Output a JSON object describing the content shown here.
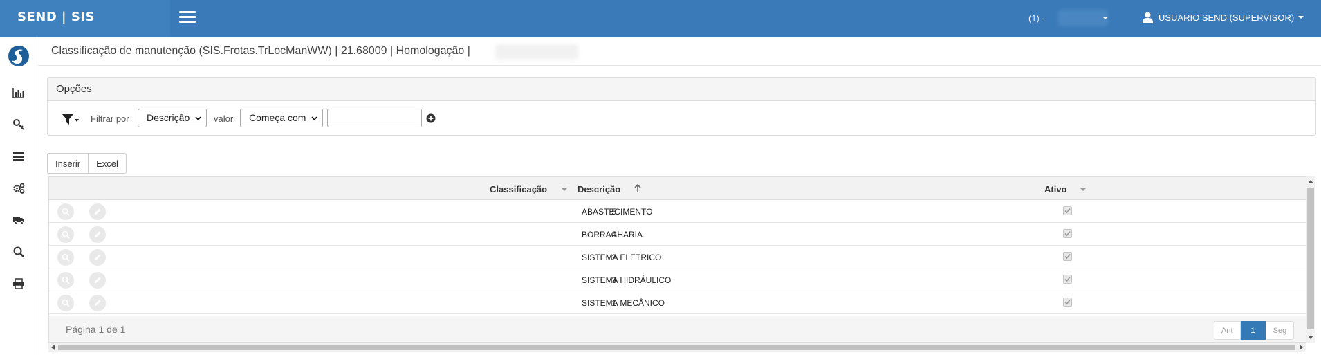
{
  "app": {
    "brand": "SEND | SIS",
    "company_label": "(1) -",
    "user_label": "USUARIO SEND (SUPERVISOR)"
  },
  "colors": {
    "topbar": "#3a7ab8",
    "accent": "#337ab7"
  },
  "sidebar": {
    "icons": [
      "logo-icon",
      "bar-chart-icon",
      "key-icon",
      "server-icon",
      "gears-icon",
      "truck-icon",
      "search-icon",
      "print-icon"
    ]
  },
  "page": {
    "title": "Classificação de manutenção (SIS.Frotas.TrLocManWW) | 21.68009 | Homologação |"
  },
  "options": {
    "title": "Opções",
    "filter_by_label": "Filtrar por",
    "filter_field": "Descrição",
    "value_label": "valor",
    "operator": "Começa com",
    "value": ""
  },
  "toolbar": {
    "insert_label": "Inserir",
    "excel_label": "Excel"
  },
  "grid": {
    "columns": [
      "Classificação",
      "Descrição",
      "Ativo"
    ],
    "rows": [
      {
        "classificacao": "5",
        "descricao": "ABASTECIMENTO",
        "ativo": true
      },
      {
        "classificacao": "4",
        "descricao": "BORRACHARIA",
        "ativo": true
      },
      {
        "classificacao": "2",
        "descricao": "SISTEMA ELETRICO",
        "ativo": true
      },
      {
        "classificacao": "3",
        "descricao": "SISTEMA HIDRÁULICO",
        "ativo": true
      },
      {
        "classificacao": "1",
        "descricao": "SISTEMA MECÂNICO",
        "ativo": true
      }
    ],
    "page_info": "Página 1 de 1",
    "pager": {
      "prev": "Ant",
      "current": "1",
      "next": "Seg"
    }
  }
}
